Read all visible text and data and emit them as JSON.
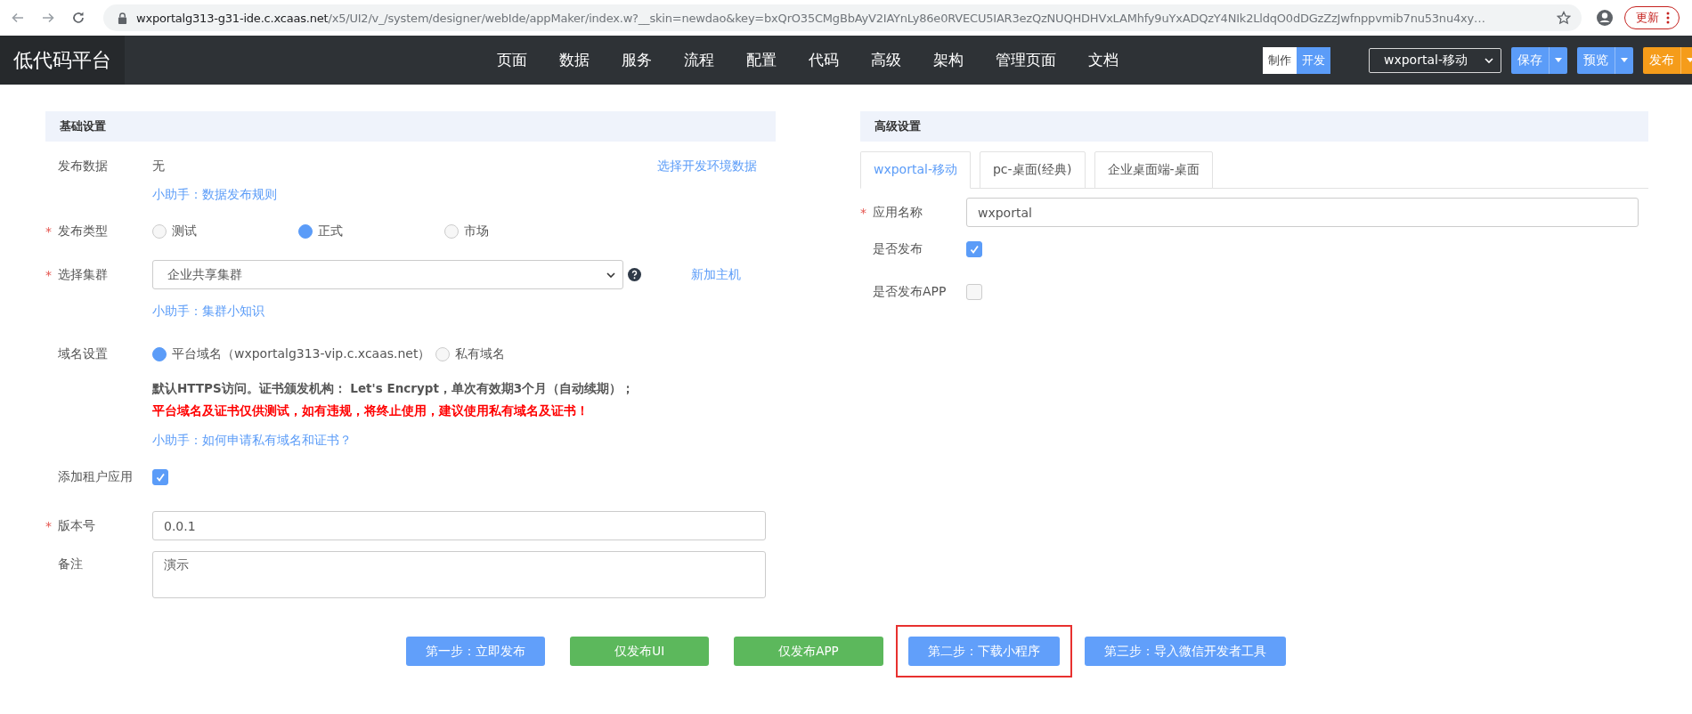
{
  "browser": {
    "url_host": "wxportalg313-g31-ide.c.xcaas.net",
    "url_path": "/x5/UI2/v_/system/designer/webIde/appMaker/index.w?__skin=newdao&key=bxQrO35CMgBbAyV2IAYnLy86e0RVECU5IAR3ezQzNUQHDHVxLAMhfy9uYxADQzY4NIk2LldqO0dDGzZzJwfnppvmib7nu53nu4xy…",
    "update_button": "更新"
  },
  "header": {
    "logo": "低代码平台",
    "nav": [
      "页面",
      "数据",
      "服务",
      "流程",
      "配置",
      "代码",
      "高级",
      "架构",
      "管理页面",
      "文档"
    ],
    "mode_toggle": [
      {
        "label": "制作",
        "selected": false
      },
      {
        "label": "开发",
        "selected": true
      }
    ],
    "app_select": "wxportal-移动",
    "actions": [
      {
        "label": "保存",
        "color": "#5b9cf8"
      },
      {
        "label": "预览",
        "color": "#5b9cf8"
      },
      {
        "label": "发布",
        "color": "#f59c1a"
      }
    ]
  },
  "basic": {
    "title": "基础设置",
    "publish_data": {
      "label": "发布数据",
      "value": "无",
      "link": "选择开发环境数据",
      "help": "小助手：数据发布规则"
    },
    "publish_type": {
      "label": "发布类型",
      "mark": "*",
      "options": [
        {
          "label": "测试",
          "selected": false
        },
        {
          "label": "正式",
          "selected": true
        },
        {
          "label": "市场",
          "selected": false
        }
      ]
    },
    "cluster": {
      "label": "选择集群",
      "mark": "*",
      "value": "企业共享集群",
      "link": "新加主机",
      "help": "小助手：集群小知识"
    },
    "domain": {
      "label": "域名设置",
      "options": [
        {
          "label": "平台域名（wxportalg313-vip.c.xcaas.net）",
          "selected": true
        },
        {
          "label": "私有域名",
          "selected": false
        }
      ],
      "notice": "默认HTTPS访问。证书颁发机构： Let's Encrypt，单次有效期3个月（自动续期）；",
      "warning": "平台域名及证书仅供测试，如有违规，将终止使用，建议使用私有域名及证书！",
      "help": "小助手：如何申请私有域名和证书？"
    },
    "tenant": {
      "label": "添加租户应用",
      "checked": true
    },
    "version": {
      "label": "版本号",
      "mark": "*",
      "value": "0.0.1"
    },
    "remark": {
      "label": "备注",
      "value": "演示"
    }
  },
  "advanced": {
    "title": "高级设置",
    "tabs": [
      {
        "label": "wxportal-移动",
        "selected": true
      },
      {
        "label": "pc-桌面(经典)",
        "selected": false
      },
      {
        "label": "企业桌面端-桌面",
        "selected": false
      }
    ],
    "app_name": {
      "label": "应用名称",
      "mark": "*",
      "value": "wxportal"
    },
    "publish": {
      "label": "是否发布",
      "checked": true
    },
    "publish_app": {
      "label": "是否发布APP",
      "checked": false
    }
  },
  "footer_buttons": [
    {
      "label": "第一步：立即发布",
      "kind": "primary",
      "highlighted": false
    },
    {
      "label": "仅发布UI",
      "kind": "success",
      "highlighted": false
    },
    {
      "label": "仅发布APP",
      "kind": "success",
      "highlighted": false
    },
    {
      "label": "第二步：下载小程序",
      "kind": "primary",
      "highlighted": true
    },
    {
      "label": "第三步：导入微信开发者工具",
      "kind": "primary",
      "highlighted": false
    }
  ]
}
